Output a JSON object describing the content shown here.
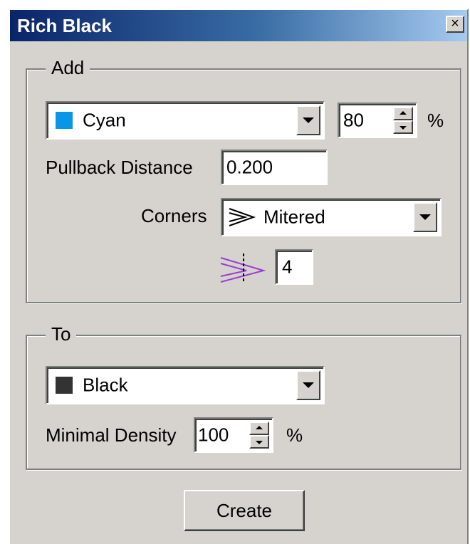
{
  "window": {
    "title": "Rich Black",
    "close_glyph": "×"
  },
  "add_group": {
    "legend": "Add",
    "ink_select": {
      "value": "Cyan",
      "swatch_color": "#0a96e6"
    },
    "percent": {
      "value": "80",
      "unit": "%"
    },
    "pullback": {
      "label": "Pullback Distance",
      "value": "0.200"
    },
    "corners": {
      "label": "Corners",
      "value": "Mitered",
      "icon": "mitered-corner-icon"
    },
    "miter_limit": {
      "icon": "miter-limit-icon",
      "value": "4"
    }
  },
  "to_group": {
    "legend": "To",
    "ink_select": {
      "value": "Black",
      "swatch_color": "#333333"
    },
    "min_density": {
      "label": "Minimal Density",
      "value": "100",
      "unit": "%"
    }
  },
  "create_button": {
    "label": "Create"
  }
}
